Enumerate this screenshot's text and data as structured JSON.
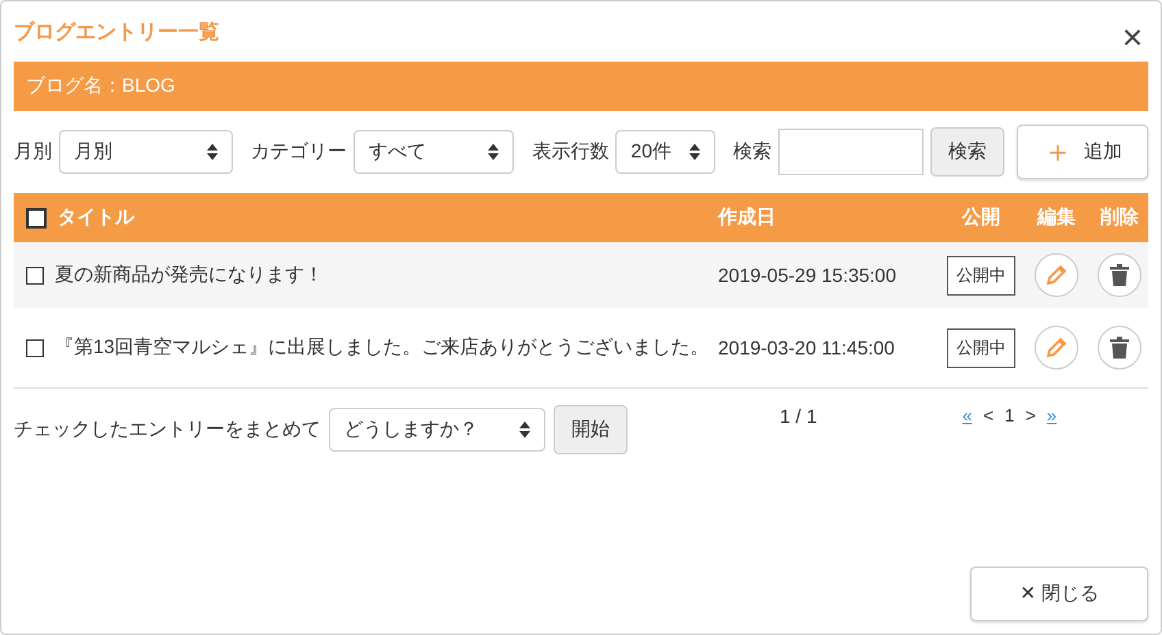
{
  "window": {
    "title": "ブログエントリー一覧",
    "close": "×"
  },
  "blog_bar": {
    "label": "ブログ名：BLOG"
  },
  "filters": [
    {
      "label": "月別",
      "value": "月別"
    },
    {
      "label": "カテゴリー",
      "value": "すべて"
    },
    {
      "label": "表示行数",
      "value": "20件"
    }
  ],
  "search": {
    "label": "検索",
    "button": "検索"
  },
  "add_button": {
    "icon": "＋",
    "label": "追加"
  },
  "table": {
    "columns": [
      "タイトル",
      "作成日",
      "公開",
      "編集",
      "削除"
    ],
    "header_checked": false,
    "rows": [
      {
        "checked": false,
        "title": "夏の新商品が発売になります！",
        "date": "2019-05-29 15:35:00",
        "status": "公開中"
      },
      {
        "checked": false,
        "title": "『第13回青空マルシェ』に出展しました。ご来店ありがとうございました。",
        "date": "2019-03-20 11:45:00",
        "status": "公開中"
      }
    ]
  },
  "bulk": {
    "label": "チェックしたエントリーをまとめて",
    "value": "どうしますか？",
    "button": "開始"
  },
  "page_info": "1 / 1",
  "pagination": {
    "first": "«",
    "prev": "<",
    "current": "1",
    "next": ">",
    "last": "»"
  },
  "close_button": {
    "icon": "✕",
    "label": "閉じる"
  }
}
